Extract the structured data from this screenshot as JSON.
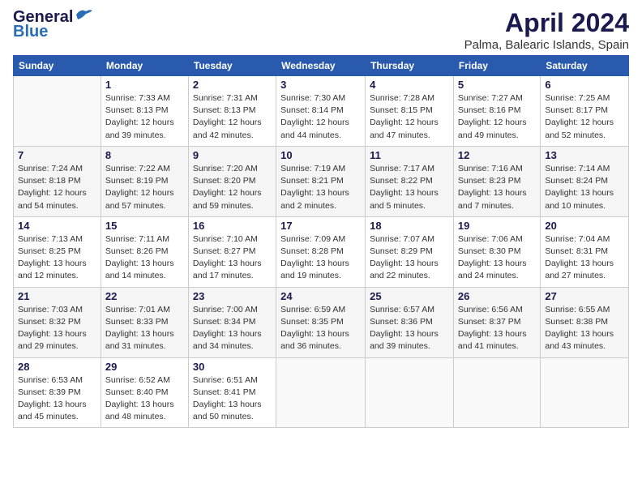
{
  "header": {
    "logo_line1": "General",
    "logo_line2": "Blue",
    "title": "April 2024",
    "subtitle": "Palma, Balearic Islands, Spain"
  },
  "calendar": {
    "headers": [
      "Sunday",
      "Monday",
      "Tuesday",
      "Wednesday",
      "Thursday",
      "Friday",
      "Saturday"
    ],
    "weeks": [
      [
        {
          "num": "",
          "info": ""
        },
        {
          "num": "1",
          "info": "Sunrise: 7:33 AM\nSunset: 8:13 PM\nDaylight: 12 hours\nand 39 minutes."
        },
        {
          "num": "2",
          "info": "Sunrise: 7:31 AM\nSunset: 8:13 PM\nDaylight: 12 hours\nand 42 minutes."
        },
        {
          "num": "3",
          "info": "Sunrise: 7:30 AM\nSunset: 8:14 PM\nDaylight: 12 hours\nand 44 minutes."
        },
        {
          "num": "4",
          "info": "Sunrise: 7:28 AM\nSunset: 8:15 PM\nDaylight: 12 hours\nand 47 minutes."
        },
        {
          "num": "5",
          "info": "Sunrise: 7:27 AM\nSunset: 8:16 PM\nDaylight: 12 hours\nand 49 minutes."
        },
        {
          "num": "6",
          "info": "Sunrise: 7:25 AM\nSunset: 8:17 PM\nDaylight: 12 hours\nand 52 minutes."
        }
      ],
      [
        {
          "num": "7",
          "info": "Sunrise: 7:24 AM\nSunset: 8:18 PM\nDaylight: 12 hours\nand 54 minutes."
        },
        {
          "num": "8",
          "info": "Sunrise: 7:22 AM\nSunset: 8:19 PM\nDaylight: 12 hours\nand 57 minutes."
        },
        {
          "num": "9",
          "info": "Sunrise: 7:20 AM\nSunset: 8:20 PM\nDaylight: 12 hours\nand 59 minutes."
        },
        {
          "num": "10",
          "info": "Sunrise: 7:19 AM\nSunset: 8:21 PM\nDaylight: 13 hours\nand 2 minutes."
        },
        {
          "num": "11",
          "info": "Sunrise: 7:17 AM\nSunset: 8:22 PM\nDaylight: 13 hours\nand 5 minutes."
        },
        {
          "num": "12",
          "info": "Sunrise: 7:16 AM\nSunset: 8:23 PM\nDaylight: 13 hours\nand 7 minutes."
        },
        {
          "num": "13",
          "info": "Sunrise: 7:14 AM\nSunset: 8:24 PM\nDaylight: 13 hours\nand 10 minutes."
        }
      ],
      [
        {
          "num": "14",
          "info": "Sunrise: 7:13 AM\nSunset: 8:25 PM\nDaylight: 13 hours\nand 12 minutes."
        },
        {
          "num": "15",
          "info": "Sunrise: 7:11 AM\nSunset: 8:26 PM\nDaylight: 13 hours\nand 14 minutes."
        },
        {
          "num": "16",
          "info": "Sunrise: 7:10 AM\nSunset: 8:27 PM\nDaylight: 13 hours\nand 17 minutes."
        },
        {
          "num": "17",
          "info": "Sunrise: 7:09 AM\nSunset: 8:28 PM\nDaylight: 13 hours\nand 19 minutes."
        },
        {
          "num": "18",
          "info": "Sunrise: 7:07 AM\nSunset: 8:29 PM\nDaylight: 13 hours\nand 22 minutes."
        },
        {
          "num": "19",
          "info": "Sunrise: 7:06 AM\nSunset: 8:30 PM\nDaylight: 13 hours\nand 24 minutes."
        },
        {
          "num": "20",
          "info": "Sunrise: 7:04 AM\nSunset: 8:31 PM\nDaylight: 13 hours\nand 27 minutes."
        }
      ],
      [
        {
          "num": "21",
          "info": "Sunrise: 7:03 AM\nSunset: 8:32 PM\nDaylight: 13 hours\nand 29 minutes."
        },
        {
          "num": "22",
          "info": "Sunrise: 7:01 AM\nSunset: 8:33 PM\nDaylight: 13 hours\nand 31 minutes."
        },
        {
          "num": "23",
          "info": "Sunrise: 7:00 AM\nSunset: 8:34 PM\nDaylight: 13 hours\nand 34 minutes."
        },
        {
          "num": "24",
          "info": "Sunrise: 6:59 AM\nSunset: 8:35 PM\nDaylight: 13 hours\nand 36 minutes."
        },
        {
          "num": "25",
          "info": "Sunrise: 6:57 AM\nSunset: 8:36 PM\nDaylight: 13 hours\nand 39 minutes."
        },
        {
          "num": "26",
          "info": "Sunrise: 6:56 AM\nSunset: 8:37 PM\nDaylight: 13 hours\nand 41 minutes."
        },
        {
          "num": "27",
          "info": "Sunrise: 6:55 AM\nSunset: 8:38 PM\nDaylight: 13 hours\nand 43 minutes."
        }
      ],
      [
        {
          "num": "28",
          "info": "Sunrise: 6:53 AM\nSunset: 8:39 PM\nDaylight: 13 hours\nand 45 minutes."
        },
        {
          "num": "29",
          "info": "Sunrise: 6:52 AM\nSunset: 8:40 PM\nDaylight: 13 hours\nand 48 minutes."
        },
        {
          "num": "30",
          "info": "Sunrise: 6:51 AM\nSunset: 8:41 PM\nDaylight: 13 hours\nand 50 minutes."
        },
        {
          "num": "",
          "info": ""
        },
        {
          "num": "",
          "info": ""
        },
        {
          "num": "",
          "info": ""
        },
        {
          "num": "",
          "info": ""
        }
      ]
    ]
  }
}
